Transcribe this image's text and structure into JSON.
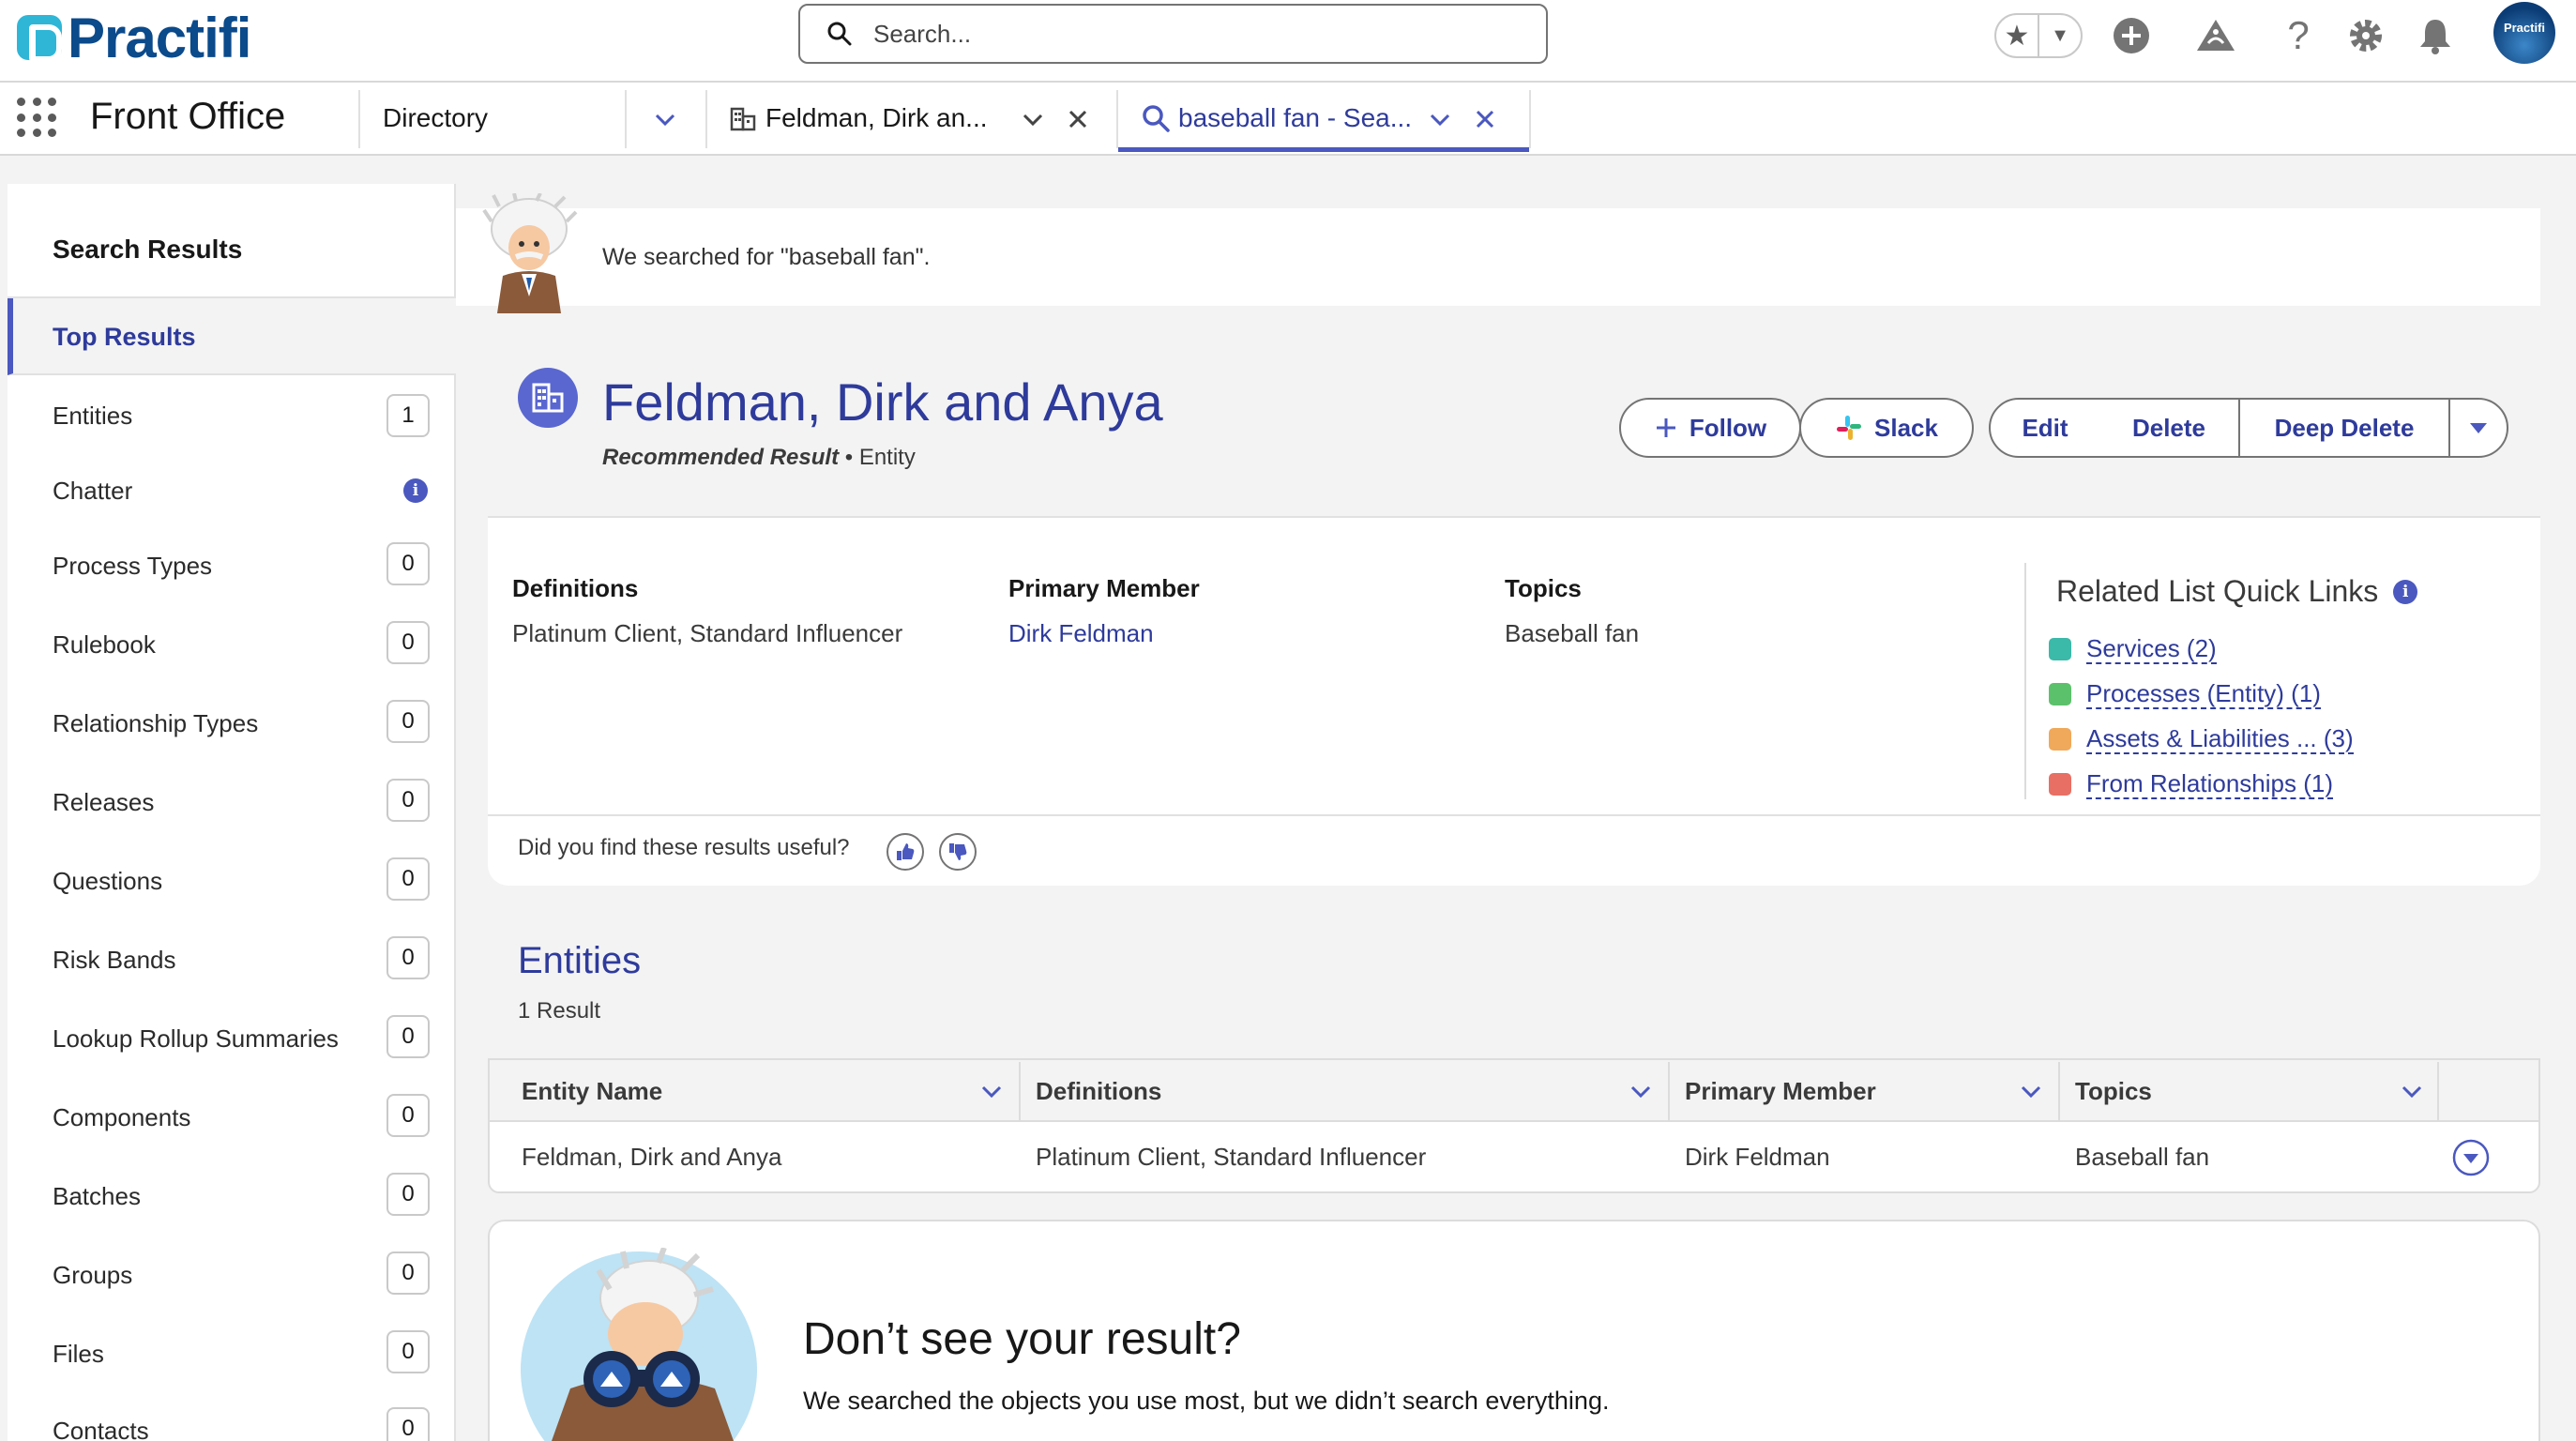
{
  "header": {
    "logo_text": "Practifi",
    "search_placeholder": "Search...",
    "avatar_text": "Practifi"
  },
  "nav": {
    "app_name": "Front Office",
    "object_selector": "Directory",
    "tabs": [
      {
        "label": "Feldman, Dirk an..."
      },
      {
        "label": "baseball fan - Sea..."
      }
    ]
  },
  "sidebar": {
    "title": "Search Results",
    "selected": "Top Results",
    "items": [
      {
        "label": "Entities",
        "count": "1"
      },
      {
        "label": "Chatter",
        "count": ""
      },
      {
        "label": "Process Types",
        "count": "0"
      },
      {
        "label": "Rulebook",
        "count": "0"
      },
      {
        "label": "Relationship Types",
        "count": "0"
      },
      {
        "label": "Releases",
        "count": "0"
      },
      {
        "label": "Questions",
        "count": "0"
      },
      {
        "label": "Risk Bands",
        "count": "0"
      },
      {
        "label": "Lookup Rollup Summaries",
        "count": "0"
      },
      {
        "label": "Components",
        "count": "0"
      },
      {
        "label": "Batches",
        "count": "0"
      },
      {
        "label": "Groups",
        "count": "0"
      },
      {
        "label": "Files",
        "count": "0"
      },
      {
        "label": "Contacts",
        "count": "0"
      }
    ]
  },
  "banner": {
    "text": "We searched for \"baseball fan\"."
  },
  "result": {
    "title": "Feldman, Dirk and Anya",
    "recommended": "Recommended Result",
    "type": "Entity",
    "buttons": {
      "follow": "Follow",
      "slack": "Slack",
      "edit": "Edit",
      "delete": "Delete",
      "deep_delete": "Deep Delete"
    },
    "fields": {
      "definitions_label": "Definitions",
      "definitions_value": "Platinum Client, Standard Influencer",
      "primary_member_label": "Primary Member",
      "primary_member_value": "Dirk Feldman",
      "topics_label": "Topics",
      "topics_value": "Baseball fan"
    },
    "quick_links": {
      "title": "Related List Quick Links",
      "links": [
        {
          "label": "Services (2)",
          "color": "#3bb9a9"
        },
        {
          "label": "Processes (Entity) (1)",
          "color": "#5cc16b"
        },
        {
          "label": "Assets & Liabilities ... (3)",
          "color": "#f0a95a"
        },
        {
          "label": "From Relationships (1)",
          "color": "#e86f63"
        }
      ]
    },
    "feedback": "Did you find these results useful?"
  },
  "entities": {
    "title": "Entities",
    "count_text": "1 Result",
    "columns": [
      "Entity Name",
      "Definitions",
      "Primary Member",
      "Topics"
    ],
    "rows": [
      [
        "Feldman, Dirk and Anya",
        "Platinum Client, Standard Influencer",
        "Dirk Feldman",
        "Baseball fan"
      ]
    ]
  },
  "not_found": {
    "title": "Don’t see your result?",
    "text": "We searched the objects you use most, but we didn’t search everything."
  },
  "colors": {
    "brand": "#4a58bf",
    "link": "#2e3b9b",
    "logo": "#0b4a8b"
  }
}
